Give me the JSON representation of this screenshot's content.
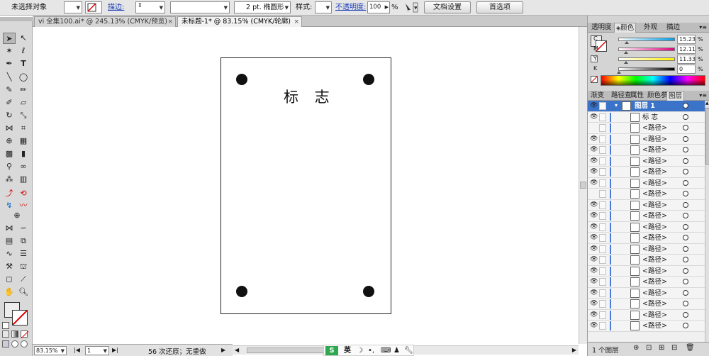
{
  "control_bar": {
    "selection_status": "未选择对象",
    "stroke_label": "描边:",
    "stroke_profile": "2 pt. 椭圆形",
    "style_label": "样式:",
    "opacity_label": "不透明度:",
    "opacity_value": "100",
    "opacity_unit": "%",
    "doc_setup_button": "文档设置",
    "preferences_button": "首选项"
  },
  "tabs": [
    {
      "label": "vi 全集100.ai* @ 245.13% (CMYK/预览)",
      "close": "×"
    },
    {
      "label": "未标题-1* @ 83.15% (CMYK/轮廓)",
      "close": "×"
    }
  ],
  "artboard": {
    "logo_text": "标 志"
  },
  "status": {
    "zoom": "83.15%",
    "page": "1",
    "undo_info": "56 次还原；无重做"
  },
  "color_panel": {
    "tabs": [
      "透明度",
      "颜色",
      "外观",
      "描边"
    ],
    "active_tab": "颜色",
    "channels": [
      {
        "name": "C",
        "value": "15.23",
        "fraction": 0.1523,
        "color": "#00a0e9"
      },
      {
        "name": "M",
        "value": "12.11",
        "fraction": 0.1211,
        "color": "#e4007f"
      },
      {
        "name": "Y",
        "value": "11.33",
        "fraction": 0.1133,
        "color": "#fff100"
      },
      {
        "name": "K",
        "value": "0",
        "fraction": 0.0,
        "color": "#000000"
      }
    ],
    "unit": "%"
  },
  "layers_panel": {
    "tabs": [
      "渐变",
      "路径查",
      "属性",
      "颜色参",
      "图层"
    ],
    "active_tab": "图层",
    "layer_name": "图层 1",
    "items": [
      {
        "name": "标 志",
        "eye": true
      },
      {
        "name": "<路径>",
        "eye": false
      },
      {
        "name": "<路径>",
        "eye": true
      },
      {
        "name": "<路径>",
        "eye": true
      },
      {
        "name": "<路径>",
        "eye": true
      },
      {
        "name": "<路径>",
        "eye": true
      },
      {
        "name": "<路径>",
        "eye": true
      },
      {
        "name": "<路径>",
        "eye": false
      },
      {
        "name": "<路径>",
        "eye": true
      },
      {
        "name": "<路径>",
        "eye": true
      },
      {
        "name": "<路径>",
        "eye": true
      },
      {
        "name": "<路径>",
        "eye": true
      },
      {
        "name": "<路径>",
        "eye": true
      },
      {
        "name": "<路径>",
        "eye": true
      },
      {
        "name": "<路径>",
        "eye": true
      },
      {
        "name": "<路径>",
        "eye": true
      },
      {
        "name": "<路径>",
        "eye": true
      },
      {
        "name": "<路径>",
        "eye": true
      },
      {
        "name": "<路径>",
        "eye": true
      },
      {
        "name": "<路径>",
        "eye": true
      }
    ],
    "footer_label": "1 个图层"
  },
  "ime": {
    "lang": "英"
  }
}
